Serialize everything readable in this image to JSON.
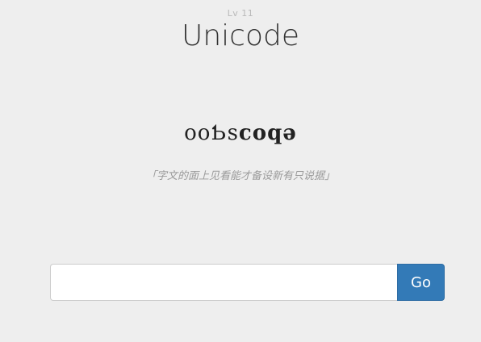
{
  "header": {
    "level": "Lv 11",
    "title": "Unicode"
  },
  "puzzle": {
    "text_light": "ooƄs",
    "text_bold": "coqǝ",
    "hint": "「字文的面上见看能才备设新有只说据」"
  },
  "answer": {
    "value": "",
    "placeholder": "",
    "submit_label": "Go"
  },
  "colors": {
    "background": "#eeeeee",
    "accent": "#337ab7"
  }
}
